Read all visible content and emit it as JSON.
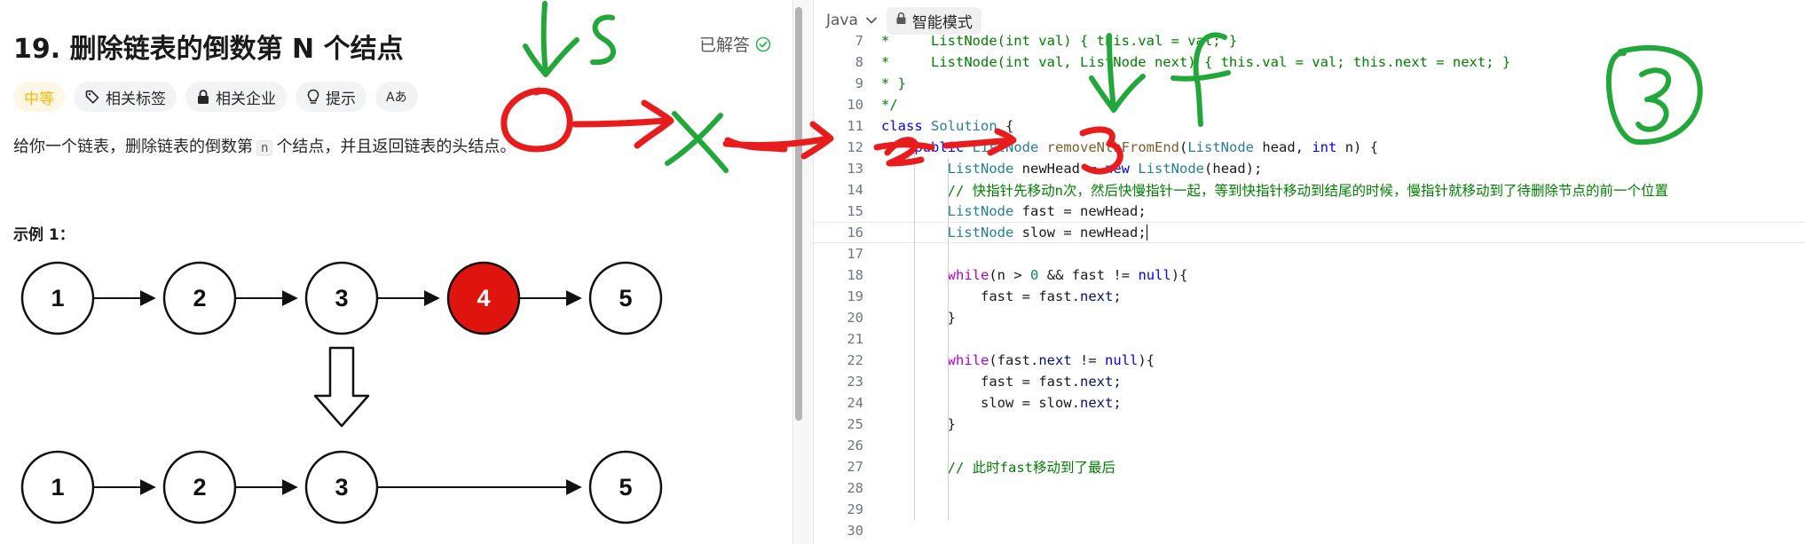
{
  "problem": {
    "title": "19. 删除链表的倒数第 N 个结点",
    "status": "已解答",
    "tags": {
      "difficulty": "中等",
      "related_tags": "相关标签",
      "related_companies": "相关企业",
      "hint": "提示",
      "font_size": "Aあ"
    },
    "description_before": "给你一个链表，删除链表的倒数第",
    "description_code": "n",
    "description_after": "个结点，并且返回链表的头结点。",
    "example_title": "示例 1：",
    "list_before": [
      "1",
      "2",
      "3",
      "4",
      "5"
    ],
    "list_after": [
      "1",
      "2",
      "3",
      "5"
    ],
    "highlighted_node": "4"
  },
  "editor": {
    "language": "Java",
    "mode": "智能模式",
    "active_line": "16",
    "lines": [
      {
        "n": "7",
        "t": "*     ListNode(int val) { this.val = val; }"
      },
      {
        "n": "8",
        "t": "*     ListNode(int val, ListNode next) { this.val = val; this.next = next; }"
      },
      {
        "n": "9",
        "t": "* }"
      },
      {
        "n": "10",
        "t": "*/"
      },
      {
        "n": "11",
        "t": "class Solution {"
      },
      {
        "n": "12",
        "t": "    public ListNode removeNthFromEnd(ListNode head, int n) {"
      },
      {
        "n": "13",
        "t": "        ListNode newHead = new ListNode(head);"
      },
      {
        "n": "14",
        "t": "        // 快指针先移动n次，然后快慢指针一起，等到快指针移动到结尾的时候，慢指针就移动到了待删除节点的前一个位置"
      },
      {
        "n": "15",
        "t": "        ListNode fast = newHead;"
      },
      {
        "n": "16",
        "t": "        ListNode slow = newHead;"
      },
      {
        "n": "17",
        "t": ""
      },
      {
        "n": "18",
        "t": "        while(n > 0 && fast != null){"
      },
      {
        "n": "19",
        "t": "            fast = fast.next;"
      },
      {
        "n": "20",
        "t": "        }"
      },
      {
        "n": "21",
        "t": ""
      },
      {
        "n": "22",
        "t": "        while(fast.next != null){"
      },
      {
        "n": "23",
        "t": "            fast = fast.next;"
      },
      {
        "n": "24",
        "t": "            slow = slow.next;"
      },
      {
        "n": "25",
        "t": "        }"
      },
      {
        "n": "26",
        "t": ""
      },
      {
        "n": "27",
        "t": "        // 此时fast移动到了最后"
      },
      {
        "n": "28",
        "t": ""
      },
      {
        "n": "29",
        "t": ""
      },
      {
        "n": "30",
        "t": ""
      }
    ]
  },
  "annotations": {
    "labels": {
      "s": "s",
      "f": "f",
      "nodes": [
        "0",
        "2",
        "3"
      ],
      "circled": "3"
    },
    "colors": {
      "green": "#22a83a",
      "red": "#e81c1c"
    }
  },
  "colors": {
    "difficulty": "#ffb800",
    "node_highlight": "#e0140f",
    "solved_check": "#2db55d",
    "comment": "#008000",
    "keyword": "#0000ff",
    "type": "#267f99"
  }
}
